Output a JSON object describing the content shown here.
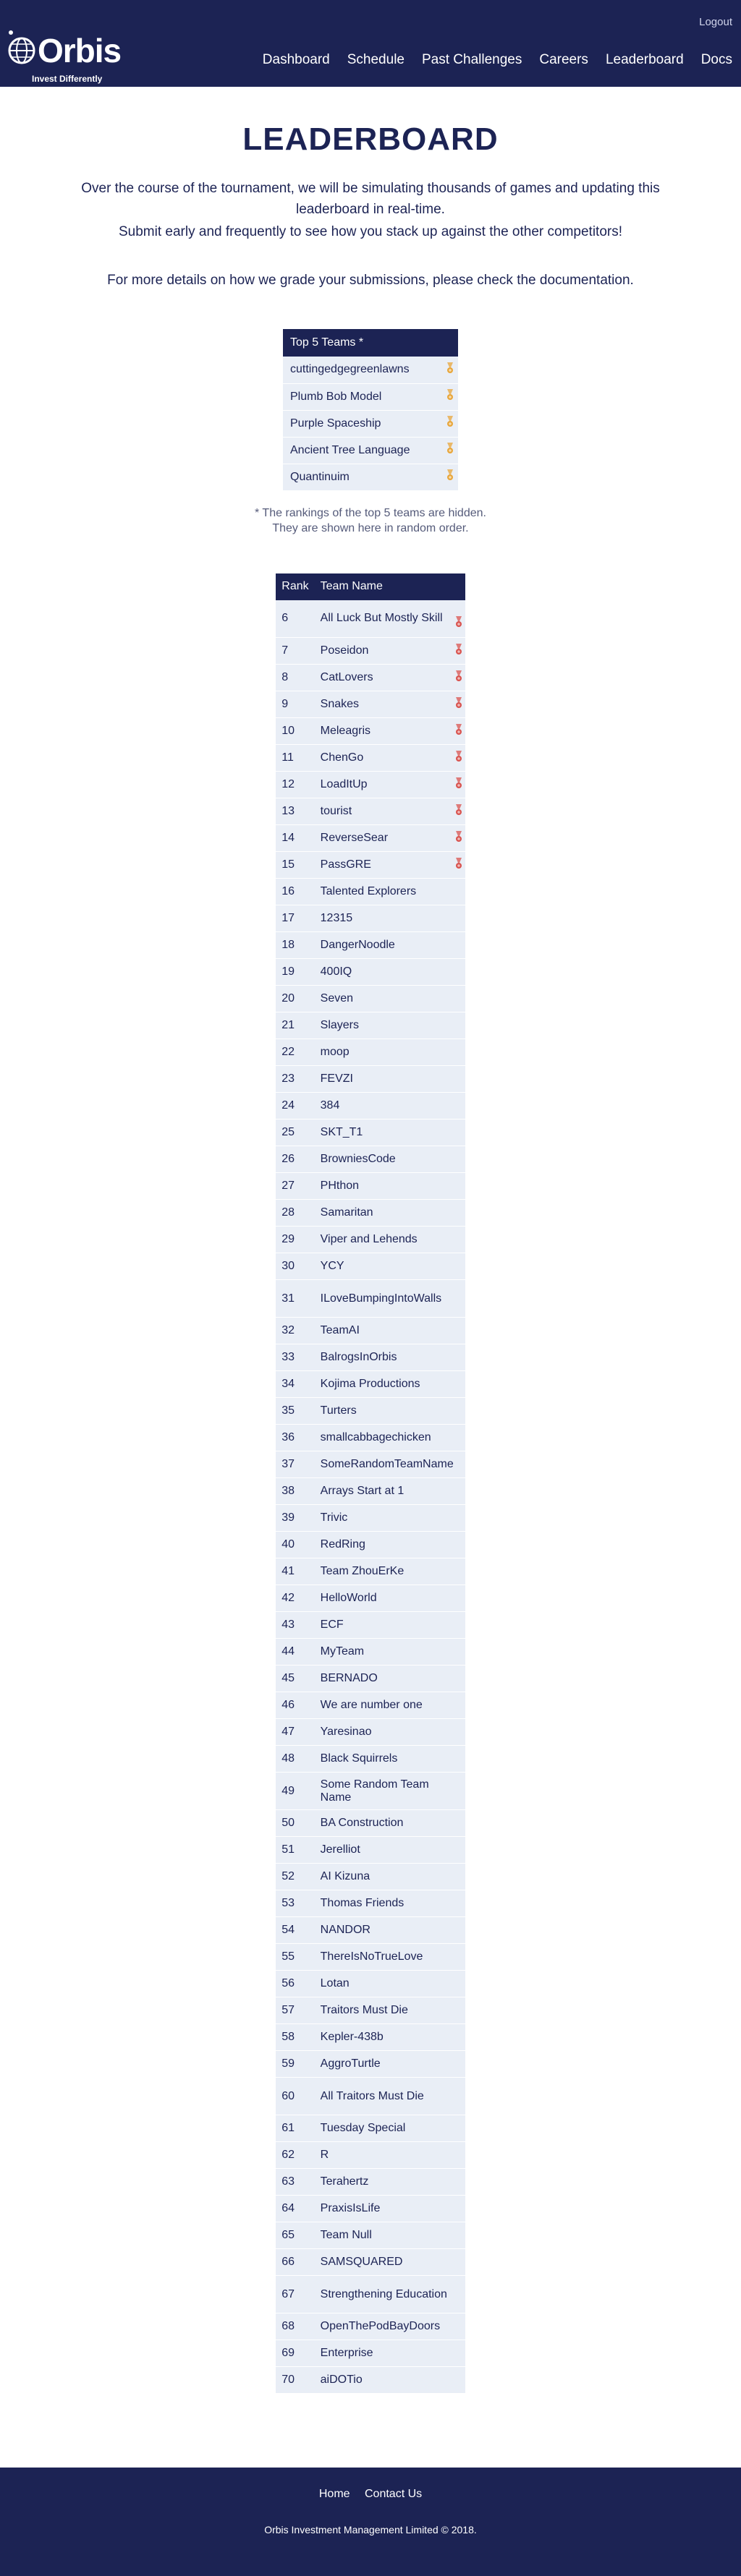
{
  "header": {
    "brand": "Orbis",
    "tagline": "Invest Differently",
    "logout": "Logout",
    "nav": [
      "Dashboard",
      "Schedule",
      "Past Challenges",
      "Careers",
      "Leaderboard",
      "Docs"
    ]
  },
  "main": {
    "title": "LEADERBOARD",
    "intro": "Over the course of the tournament, we will be simulating thousands of games and updating this leaderboard in real-time.",
    "intro2": "Submit early and frequently to see how you stack up against the other competitors!",
    "docs_note": "For more details on how we grade your submissions, please check the documentation."
  },
  "top5": {
    "header": "Top 5 Teams *",
    "teams": [
      "cuttingedgegreenlawns",
      "Plumb Bob Model",
      "Purple Spaceship",
      "Ancient Tree Language",
      "Quantinuim"
    ],
    "icon": "medal-icon",
    "icon_color": "#e8a63a",
    "footnote_line1": "* The rankings of the top 5 teams are hidden.",
    "footnote_line2": "They are shown here in random order."
  },
  "leaderboard": {
    "col_rank": "Rank",
    "col_team": "Team Name",
    "medal_color": "#d9534f",
    "rows": [
      {
        "rank": "6",
        "team": "All Luck But Mostly Skill",
        "medal": true
      },
      {
        "rank": "7",
        "team": "Poseidon",
        "medal": true
      },
      {
        "rank": "8",
        "team": "CatLovers",
        "medal": true
      },
      {
        "rank": "9",
        "team": "Snakes",
        "medal": true
      },
      {
        "rank": "10",
        "team": "Meleagris",
        "medal": true
      },
      {
        "rank": "11",
        "team": "ChenGo",
        "medal": true
      },
      {
        "rank": "12",
        "team": "LoadItUp",
        "medal": true
      },
      {
        "rank": "13",
        "team": "tourist",
        "medal": true
      },
      {
        "rank": "14",
        "team": "ReverseSear",
        "medal": true
      },
      {
        "rank": "15",
        "team": "PassGRE",
        "medal": true
      },
      {
        "rank": "16",
        "team": "Talented Explorers",
        "medal": false
      },
      {
        "rank": "17",
        "team": "12315",
        "medal": false
      },
      {
        "rank": "18",
        "team": "DangerNoodle",
        "medal": false
      },
      {
        "rank": "19",
        "team": "400IQ",
        "medal": false
      },
      {
        "rank": "20",
        "team": "Seven",
        "medal": false
      },
      {
        "rank": "21",
        "team": "Slayers",
        "medal": false
      },
      {
        "rank": "22",
        "team": "moop",
        "medal": false
      },
      {
        "rank": "23",
        "team": "FEVZI",
        "medal": false
      },
      {
        "rank": "24",
        "team": "384",
        "medal": false
      },
      {
        "rank": "25",
        "team": "SKT_T1",
        "medal": false
      },
      {
        "rank": "26",
        "team": "BrowniesCode",
        "medal": false
      },
      {
        "rank": "27",
        "team": "PHthon",
        "medal": false
      },
      {
        "rank": "28",
        "team": "Samaritan",
        "medal": false
      },
      {
        "rank": "29",
        "team": "Viper and Lehends",
        "medal": false
      },
      {
        "rank": "30",
        "team": "YCY",
        "medal": false
      },
      {
        "rank": "31",
        "team": "ILoveBumpingIntoWalls",
        "medal": false
      },
      {
        "rank": "32",
        "team": "TeamAI",
        "medal": false
      },
      {
        "rank": "33",
        "team": "BalrogsInOrbis",
        "medal": false
      },
      {
        "rank": "34",
        "team": "Kojima Productions",
        "medal": false
      },
      {
        "rank": "35",
        "team": "Turters",
        "medal": false
      },
      {
        "rank": "36",
        "team": "smallcabbagechicken",
        "medal": false
      },
      {
        "rank": "37",
        "team": "SomeRandomTeamName",
        "medal": false
      },
      {
        "rank": "38",
        "team": "Arrays Start at 1",
        "medal": false
      },
      {
        "rank": "39",
        "team": "Trivic",
        "medal": false
      },
      {
        "rank": "40",
        "team": "RedRing",
        "medal": false
      },
      {
        "rank": "41",
        "team": "Team ZhouErKe",
        "medal": false
      },
      {
        "rank": "42",
        "team": "HelloWorld",
        "medal": false
      },
      {
        "rank": "43",
        "team": "ECF",
        "medal": false
      },
      {
        "rank": "44",
        "team": "MyTeam",
        "medal": false
      },
      {
        "rank": "45",
        "team": "BERNADO",
        "medal": false
      },
      {
        "rank": "46",
        "team": "We are number one",
        "medal": false
      },
      {
        "rank": "47",
        "team": "Yaresinao",
        "medal": false
      },
      {
        "rank": "48",
        "team": "Black Squirrels",
        "medal": false
      },
      {
        "rank": "49",
        "team": "Some Random Team Name",
        "medal": false
      },
      {
        "rank": "50",
        "team": "BA Construction",
        "medal": false
      },
      {
        "rank": "51",
        "team": "Jerelliot",
        "medal": false
      },
      {
        "rank": "52",
        "team": "AI Kizuna",
        "medal": false
      },
      {
        "rank": "53",
        "team": "Thomas Friends",
        "medal": false
      },
      {
        "rank": "54",
        "team": "NANDOR",
        "medal": false
      },
      {
        "rank": "55",
        "team": "ThereIsNoTrueLove",
        "medal": false
      },
      {
        "rank": "56",
        "team": "Lotan",
        "medal": false
      },
      {
        "rank": "57",
        "team": "Traitors Must Die",
        "medal": false
      },
      {
        "rank": "58",
        "team": "Kepler-438b",
        "medal": false
      },
      {
        "rank": "59",
        "team": "AggroTurtle",
        "medal": false
      },
      {
        "rank": "60",
        "team": "All Traitors Must Die",
        "medal": false
      },
      {
        "rank": "61",
        "team": "Tuesday Special",
        "medal": false
      },
      {
        "rank": "62",
        "team": "R",
        "medal": false
      },
      {
        "rank": "63",
        "team": "Terahertz",
        "medal": false
      },
      {
        "rank": "64",
        "team": "PraxisIsLife",
        "medal": false
      },
      {
        "rank": "65",
        "team": "Team Null",
        "medal": false
      },
      {
        "rank": "66",
        "team": "SAMSQUARED",
        "medal": false
      },
      {
        "rank": "67",
        "team": "Strengthening Education",
        "medal": false
      },
      {
        "rank": "68",
        "team": "OpenThePodBayDoors",
        "medal": false
      },
      {
        "rank": "69",
        "team": "Enterprise",
        "medal": false
      },
      {
        "rank": "70",
        "team": "aiDOTio",
        "medal": false
      }
    ]
  },
  "footer": {
    "links": [
      "Home",
      "Contact Us"
    ],
    "copyright": "Orbis Investment Management Limited © 2018."
  }
}
